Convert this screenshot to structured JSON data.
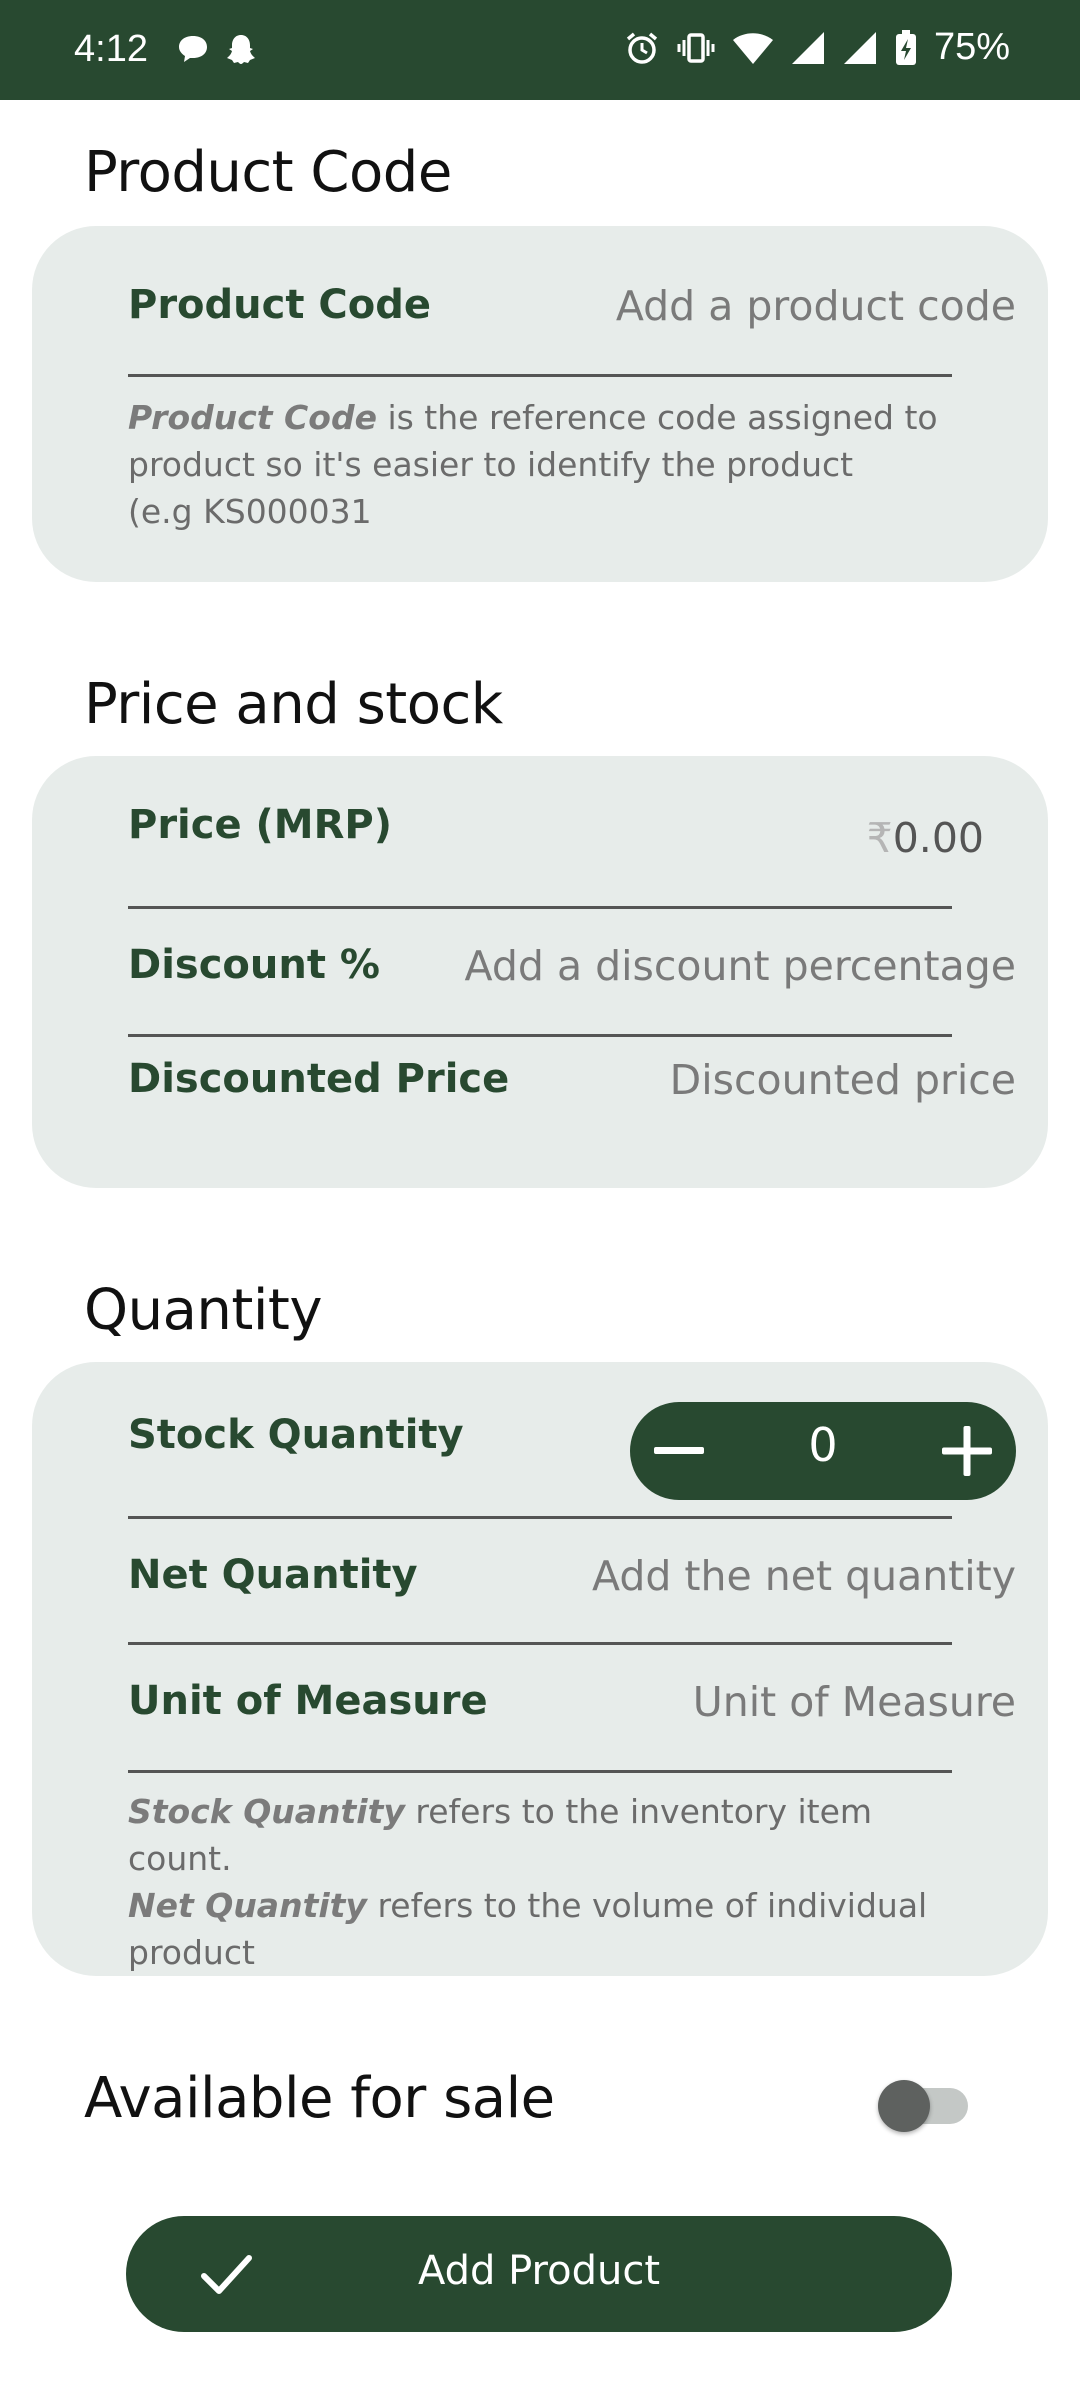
{
  "status_bar": {
    "time": "4:12",
    "battery": "75%",
    "icons_left": [
      "chat-bubble-icon",
      "snapchat-ghost-icon"
    ],
    "icons_right": [
      "alarm-icon",
      "vibrate-icon",
      "wifi-icon",
      "signal-icon",
      "signal-icon",
      "battery-charging-icon"
    ]
  },
  "product_code_section": {
    "title": "Product Code",
    "field_label": "Product Code",
    "field_placeholder": "Add a product code",
    "note_em": "Product Code",
    "note_line1_rest": " is the reference code assigned to",
    "note_line2": "product so it's easier to identify the product",
    "note_line3": " (e.g KS000031"
  },
  "price_section": {
    "title": "Price and stock",
    "price_label": "Price (MRP)",
    "currency_symbol": "₹",
    "price_value": "0.00",
    "discount_label": "Discount %",
    "discount_placeholder": "Add a discount percentage",
    "discounted_label": "Discounted Price",
    "discounted_placeholder": "Discounted price"
  },
  "quantity_section": {
    "title": "Quantity",
    "stock_label": "Stock Quantity",
    "stock_value": "0",
    "net_label": "Net Quantity",
    "net_placeholder": "Add the net quantity",
    "unit_label": "Unit of Measure",
    "unit_placeholder": "Unit of Measure",
    "note_em1": "Stock Quantity",
    "note_rest1": " refers to the inventory item count.",
    "note_em2": "Net Quantity",
    "note_rest2": " refers to the volume of individual",
    "note_line3": "product"
  },
  "availability": {
    "label": "Available for sale",
    "enabled": false
  },
  "add_button": {
    "label": "Add Product"
  },
  "colors": {
    "primary": "#284930",
    "card_bg": "#e7ecea",
    "placeholder": "#7a7a7a"
  }
}
